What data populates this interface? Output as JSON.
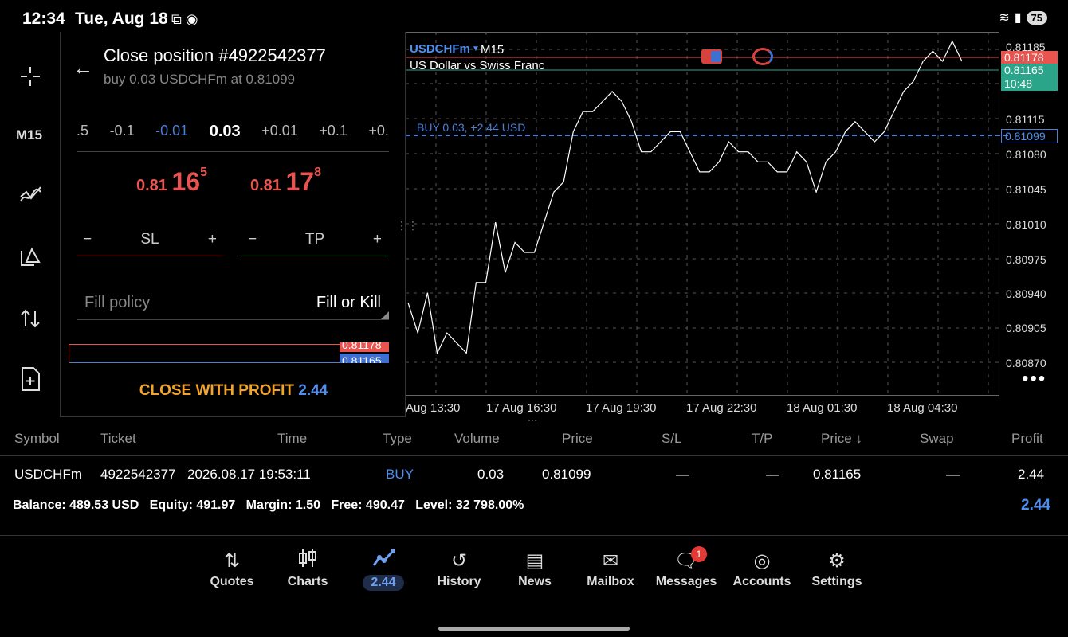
{
  "status_bar": {
    "time": "12:34",
    "date": "Tue, Aug 18",
    "battery": "75"
  },
  "toolbar": {
    "timeframe": "M15"
  },
  "close_panel": {
    "title": "Close position #4922542377",
    "subtitle": "buy 0.03 USDCHFm at 0.81099",
    "volume_steps": [
      ".5",
      "-0.1",
      "-0.01",
      "0.03",
      "+0.01",
      "+0.1",
      "+0."
    ],
    "bid": {
      "prefix": "0.81",
      "big": "16",
      "sup": "5"
    },
    "ask": {
      "prefix": "0.81",
      "big": "17",
      "sup": "8"
    },
    "sl_label": "SL",
    "tp_label": "TP",
    "minus": "−",
    "plus": "+",
    "fill_policy_label": "Fill policy",
    "fill_policy_value": "Fill or Kill",
    "mini_price_red": "0.81178",
    "mini_price_blue": "0.81165",
    "close_label": "CLOSE WITH PROFIT",
    "close_value": "2.44"
  },
  "chart": {
    "symbol": "USDCHFm",
    "timeframe": "M15",
    "description": "US Dollar vs Swiss Franc",
    "buy_line_label": "BUY 0.03,    +2.44 USD",
    "ask_tag": "0.81178",
    "bid_tag": "0.81165",
    "countdown": "10:48",
    "entry_tag": "0.81099",
    "colors": {
      "ask": "#e9544f",
      "bid": "#2ba58a",
      "entry": "#4e7fd6",
      "grid": "#666"
    }
  },
  "chart_data": {
    "type": "line",
    "title": "USDCHFm M15",
    "y_ticks": [
      "0.81185",
      "0.81115",
      "0.81080",
      "0.81045",
      "0.81010",
      "0.80975",
      "0.80940",
      "0.80905",
      "0.80870"
    ],
    "x_ticks": [
      "Aug 13:30",
      "17 Aug 16:30",
      "17 Aug 19:30",
      "17 Aug 22:30",
      "18 Aug 01:30",
      "18 Aug 04:30"
    ],
    "ylim": [
      0.8085,
      0.8119
    ],
    "series": [
      {
        "values": [
          0.8093,
          0.809,
          0.8094,
          0.8088,
          0.809,
          0.8089,
          0.8088,
          0.8095,
          0.8095,
          0.8101,
          0.8096,
          0.8099,
          0.8098,
          0.8098,
          0.8101,
          0.8104,
          0.8105,
          0.811,
          0.8112,
          0.8112,
          0.8113,
          0.8114,
          0.8113,
          0.8111,
          0.8108,
          0.8108,
          0.8109,
          0.811,
          0.811,
          0.8108,
          0.8106,
          0.8106,
          0.8107,
          0.8109,
          0.8108,
          0.8108,
          0.8107,
          0.8107,
          0.8106,
          0.8106,
          0.8108,
          0.8107,
          0.8104,
          0.8107,
          0.8108,
          0.811,
          0.8111,
          0.811,
          0.8109,
          0.811,
          0.8112,
          0.8114,
          0.8115,
          0.8117,
          0.8118,
          0.8117,
          0.8119,
          0.8117
        ]
      }
    ]
  },
  "table": {
    "headers": [
      "Symbol",
      "Ticket",
      "Time",
      "Type",
      "Volume",
      "Price",
      "S/L",
      "T/P",
      "Price ↓",
      "Swap",
      "Profit"
    ],
    "row": [
      "USDCHFm",
      "4922542377",
      "2026.08.17 19:53:11",
      "BUY",
      "0.03",
      "0.81099",
      "—",
      "—",
      "0.81165",
      "—",
      "2.44"
    ]
  },
  "summary": {
    "balance_label": "Balance:",
    "balance": "489.53 USD",
    "equity_label": "Equity:",
    "equity": "491.97",
    "margin_label": "Margin:",
    "margin": "1.50",
    "free_label": "Free:",
    "free": "490.47",
    "level_label": "Level:",
    "level": "32 798.00%",
    "total_profit": "2.44"
  },
  "nav": {
    "items": [
      "Quotes",
      "Charts",
      "2.44",
      "History",
      "News",
      "Mailbox",
      "Messages",
      "Accounts",
      "Settings"
    ],
    "messages_badge": "1"
  }
}
